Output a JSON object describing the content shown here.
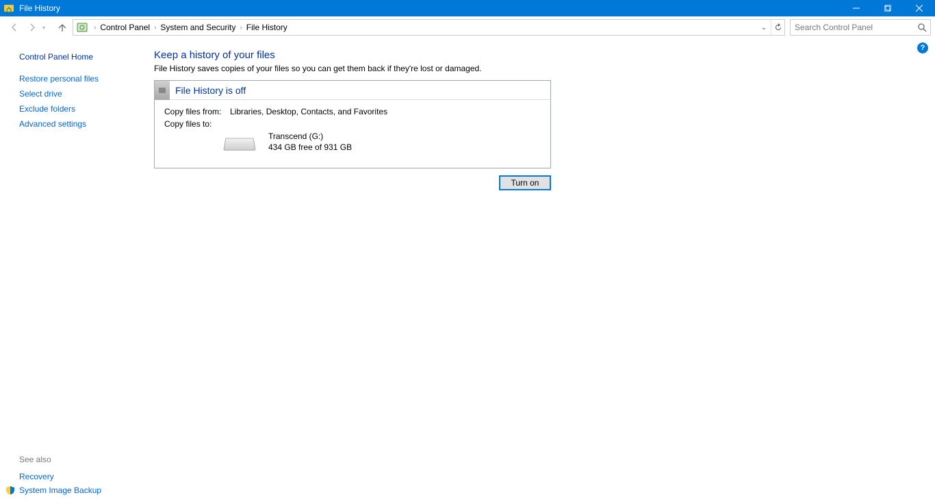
{
  "window": {
    "title": "File History"
  },
  "breadcrumb": {
    "items": [
      "Control Panel",
      "System and Security",
      "File History"
    ]
  },
  "search": {
    "placeholder": "Search Control Panel"
  },
  "sidebar": {
    "home": "Control Panel Home",
    "links": [
      "Restore personal files",
      "Select drive",
      "Exclude folders",
      "Advanced settings"
    ],
    "see_also": "See also",
    "bottom": [
      "Recovery",
      "System Image Backup"
    ]
  },
  "main": {
    "title": "Keep a history of your files",
    "subtitle": "File History saves copies of your files so you can get them back if they're lost or damaged.",
    "panel_title": "File History is off",
    "copy_from_label": "Copy files from:",
    "copy_from_value": "Libraries, Desktop, Contacts, and Favorites",
    "copy_to_label": "Copy files to:",
    "drive_name": "Transcend (G:)",
    "drive_free": "434 GB free of 931 GB",
    "turn_on": "Turn on"
  },
  "help": "?"
}
